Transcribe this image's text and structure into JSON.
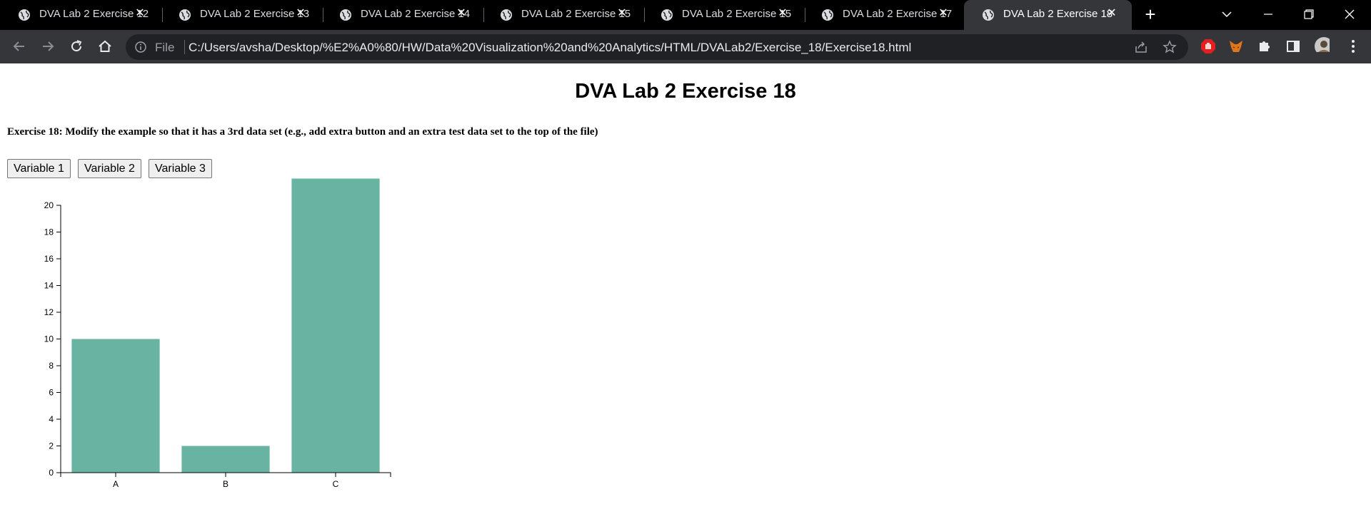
{
  "browser": {
    "tabs": [
      {
        "title": "DVA Lab 2 Exercise 12",
        "active": false
      },
      {
        "title": "DVA Lab 2 Exercise 13",
        "active": false
      },
      {
        "title": "DVA Lab 2 Exercise 14",
        "active": false
      },
      {
        "title": "DVA Lab 2 Exercise 15",
        "active": false
      },
      {
        "title": "DVA Lab 2 Exercise 15",
        "active": false
      },
      {
        "title": "DVA Lab 2 Exercise 17",
        "active": false
      },
      {
        "title": "DVA Lab 2 Exercise 18",
        "active": true
      }
    ],
    "new_tab_glyph": "+",
    "tab_close_glyph": "✕",
    "address_bar": {
      "scheme_label": "File",
      "url": "C:/Users/avsha/Desktop/%E2%A0%80/HW/Data%20Visualization%20and%20Analytics/HTML/DVALab2/Exercise_18/Exercise18.html"
    },
    "icons": {
      "back": "back-arrow-icon",
      "forward": "forward-arrow-icon",
      "reload": "reload-icon",
      "home": "home-icon",
      "info": "info-icon",
      "share": "share-icon",
      "bookmark": "star-icon",
      "extensions": [
        "adblock-icon",
        "metamask-fox-icon",
        "puzzle-icon",
        "sidepanel-icon",
        "profile-avatar-icon",
        "kebab-menu-icon"
      ]
    },
    "colors": {
      "tabstrip": "#000000",
      "toolbar": "#35363a",
      "omnibox": "#202124"
    }
  },
  "page": {
    "heading": "DVA Lab 2 Exercise 18",
    "description": "Exercise 18: Modify the example so that it has a 3rd data set (e.g., add extra button and an extra test data set to the top of the file)",
    "buttons": [
      "Variable 1",
      "Variable 2",
      "Variable 3"
    ]
  },
  "chart_data": {
    "type": "bar",
    "categories": [
      "A",
      "B",
      "C"
    ],
    "values": [
      10,
      2,
      22
    ],
    "title": "",
    "xlabel": "",
    "ylabel": "",
    "ylim": [
      0,
      20
    ],
    "yticks": [
      0,
      2,
      4,
      6,
      8,
      10,
      12,
      14,
      16,
      18,
      20
    ],
    "grid": false,
    "bar_color": "#69b3a2"
  }
}
